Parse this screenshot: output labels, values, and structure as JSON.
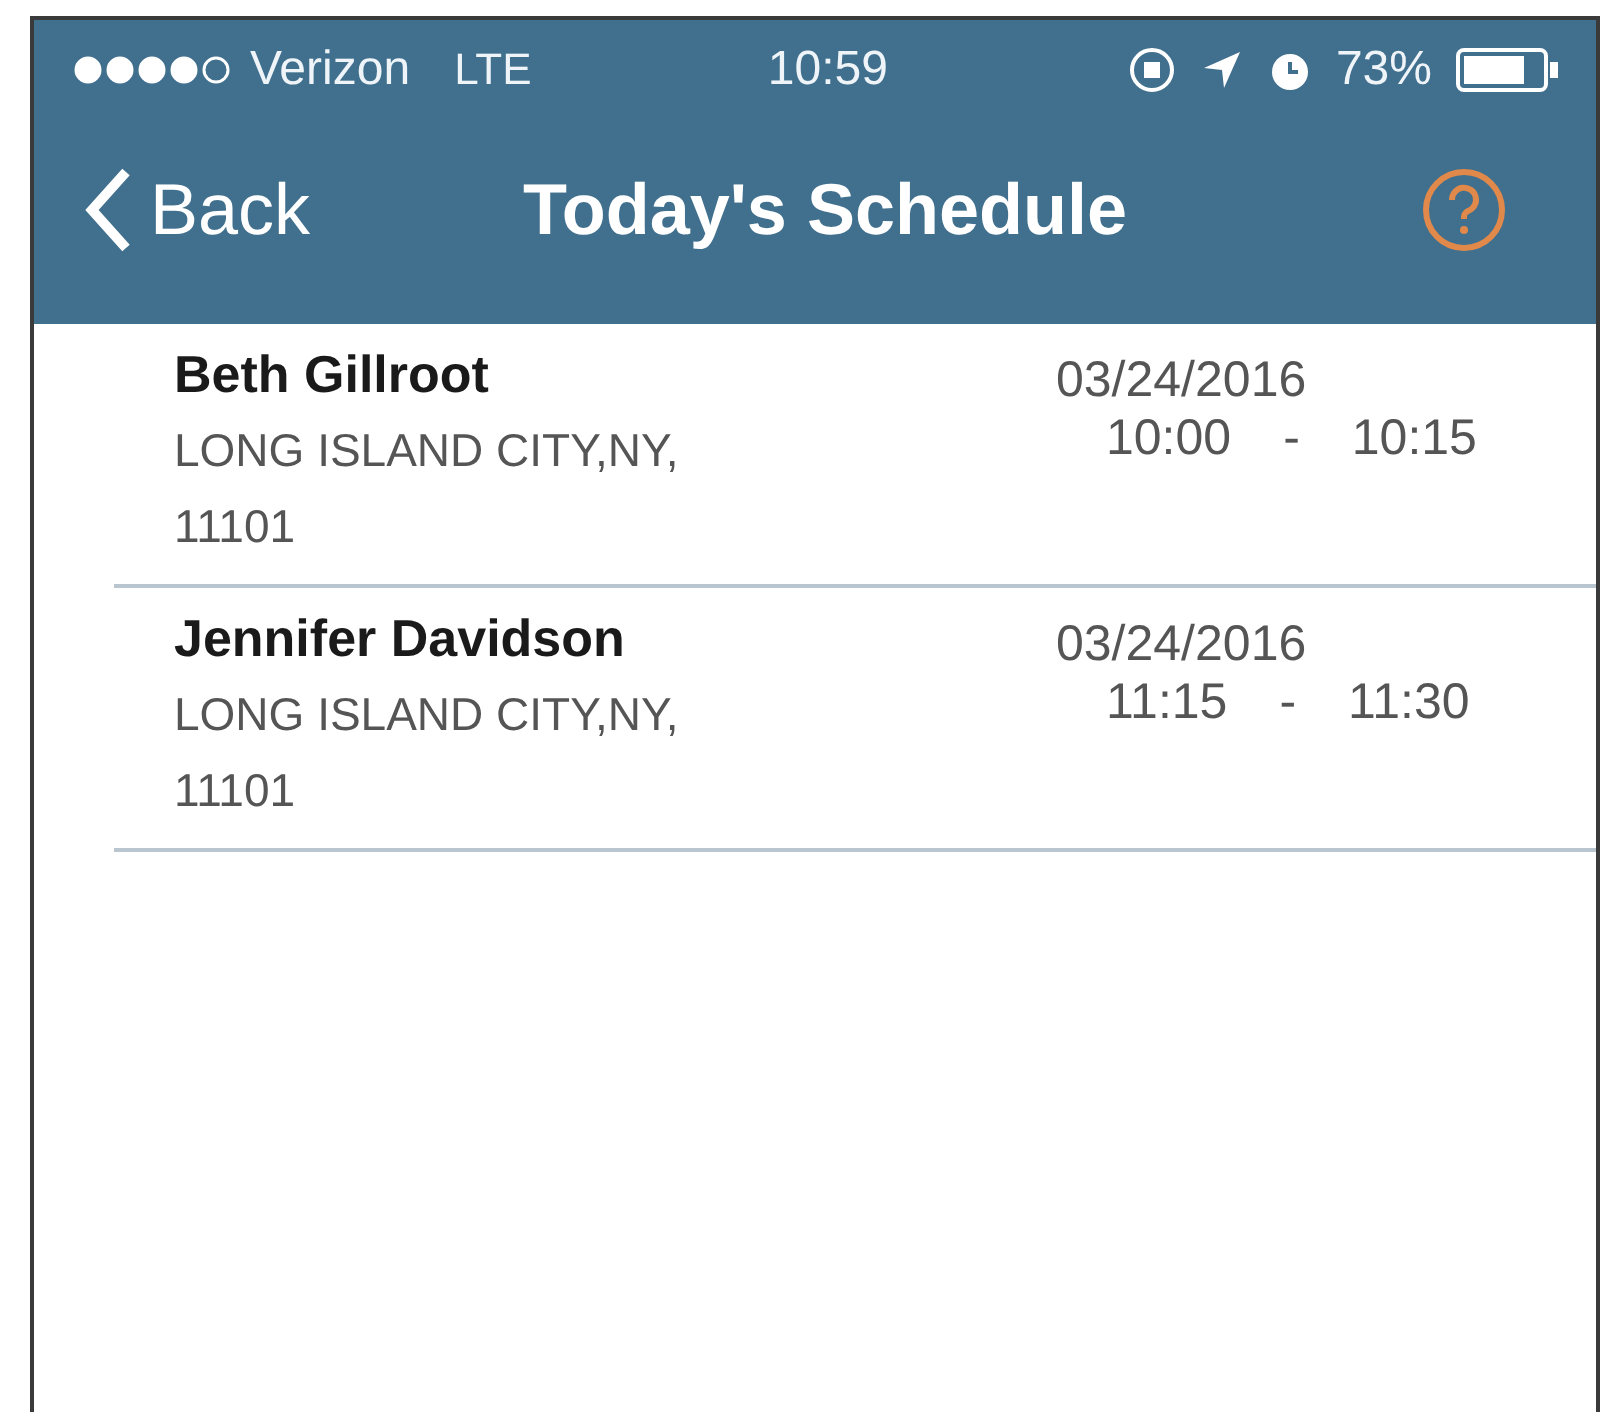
{
  "status_bar": {
    "carrier": "Verizon",
    "network": "LTE",
    "time": "10:59",
    "battery": "73%"
  },
  "nav_bar": {
    "back": "Back",
    "title": "Today's Schedule"
  },
  "appointments": [
    {
      "name": "Beth Gillroot",
      "address": "LONG ISLAND CITY,NY,",
      "zip": "11101",
      "date": "03/24/2016",
      "start": "10:00",
      "dash": "-",
      "end": "10:15"
    },
    {
      "name": "Jennifer Davidson",
      "address": "LONG ISLAND CITY,NY,",
      "zip": "11101",
      "date": "03/24/2016",
      "start": "11:15",
      "dash": "-",
      "end": "11:30"
    }
  ]
}
